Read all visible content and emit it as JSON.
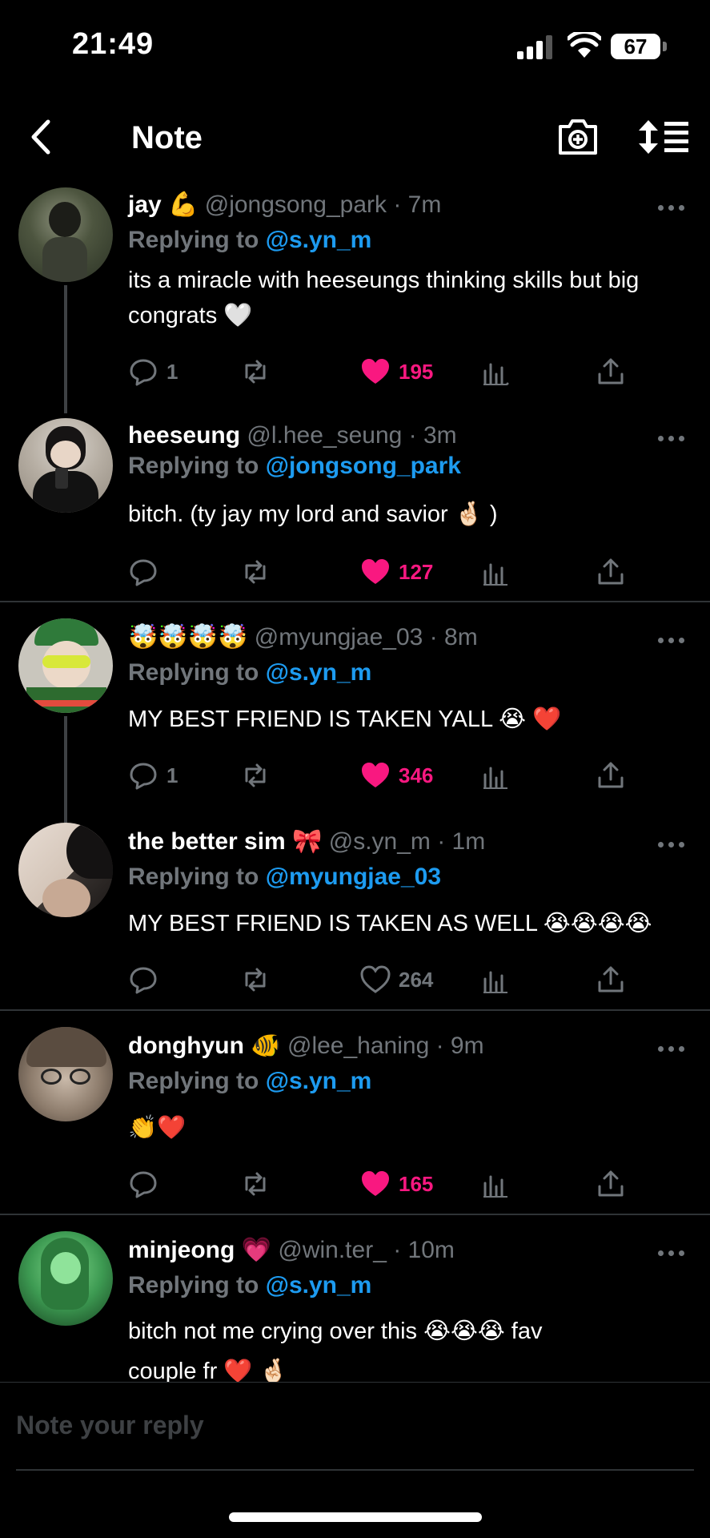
{
  "status": {
    "time": "21:49",
    "battery": "67"
  },
  "header": {
    "title": "Note"
  },
  "tweets": [
    {
      "display_name": "jay 💪",
      "handle": "@jongsong_park · 7m",
      "reply_prefix": "Replying to",
      "reply_to": "@s.yn_m",
      "body": "its a miracle with heeseungs thinking skills but big congrats 🤍",
      "replies": "1",
      "likes": "195",
      "liked": true
    },
    {
      "display_name": "heeseung",
      "handle": "@l.hee_seung · 3m",
      "reply_prefix": "Replying to",
      "reply_to": "@jongsong_park",
      "body": "bitch. (ty jay my lord and savior 🤞🏻 )",
      "replies": "",
      "likes": "127",
      "liked": true
    },
    {
      "display_name": "🤯🤯🤯🤯",
      "handle": "@myungjae_03 · 8m",
      "reply_prefix": "Replying to",
      "reply_to": "@s.yn_m",
      "body": "MY BEST FRIEND IS TAKEN YALL 😭 ❤️",
      "replies": "1",
      "likes": "346",
      "liked": true
    },
    {
      "display_name": "the better sim 🎀",
      "handle": "@s.yn_m · 1m",
      "reply_prefix": "Replying to",
      "reply_to": "@myungjae_03",
      "body": "MY BEST FRIEND IS TAKEN AS WELL 😭😭😭😭",
      "replies": "",
      "likes": "264",
      "liked": false
    },
    {
      "display_name": "donghyun 🐠",
      "handle": "@lee_haning · 9m",
      "reply_prefix": "Replying to",
      "reply_to": "@s.yn_m",
      "body": "👏❤️",
      "replies": "",
      "likes": "165",
      "liked": true
    },
    {
      "display_name": "minjeong 💗",
      "handle": "@win.ter_ · 10m",
      "reply_prefix": "Replying to",
      "reply_to": "@s.yn_m",
      "body": "bitch not me crying over this 😭😭😭  fav couple fr ❤️ 🤞🏻",
      "replies": "",
      "likes": "",
      "liked": false
    }
  ],
  "composer": {
    "placeholder": "Note your reply"
  },
  "colors": {
    "accent": "#1d9bf0",
    "like": "#f91880",
    "muted": "#71767b",
    "divider": "#2f3336"
  }
}
